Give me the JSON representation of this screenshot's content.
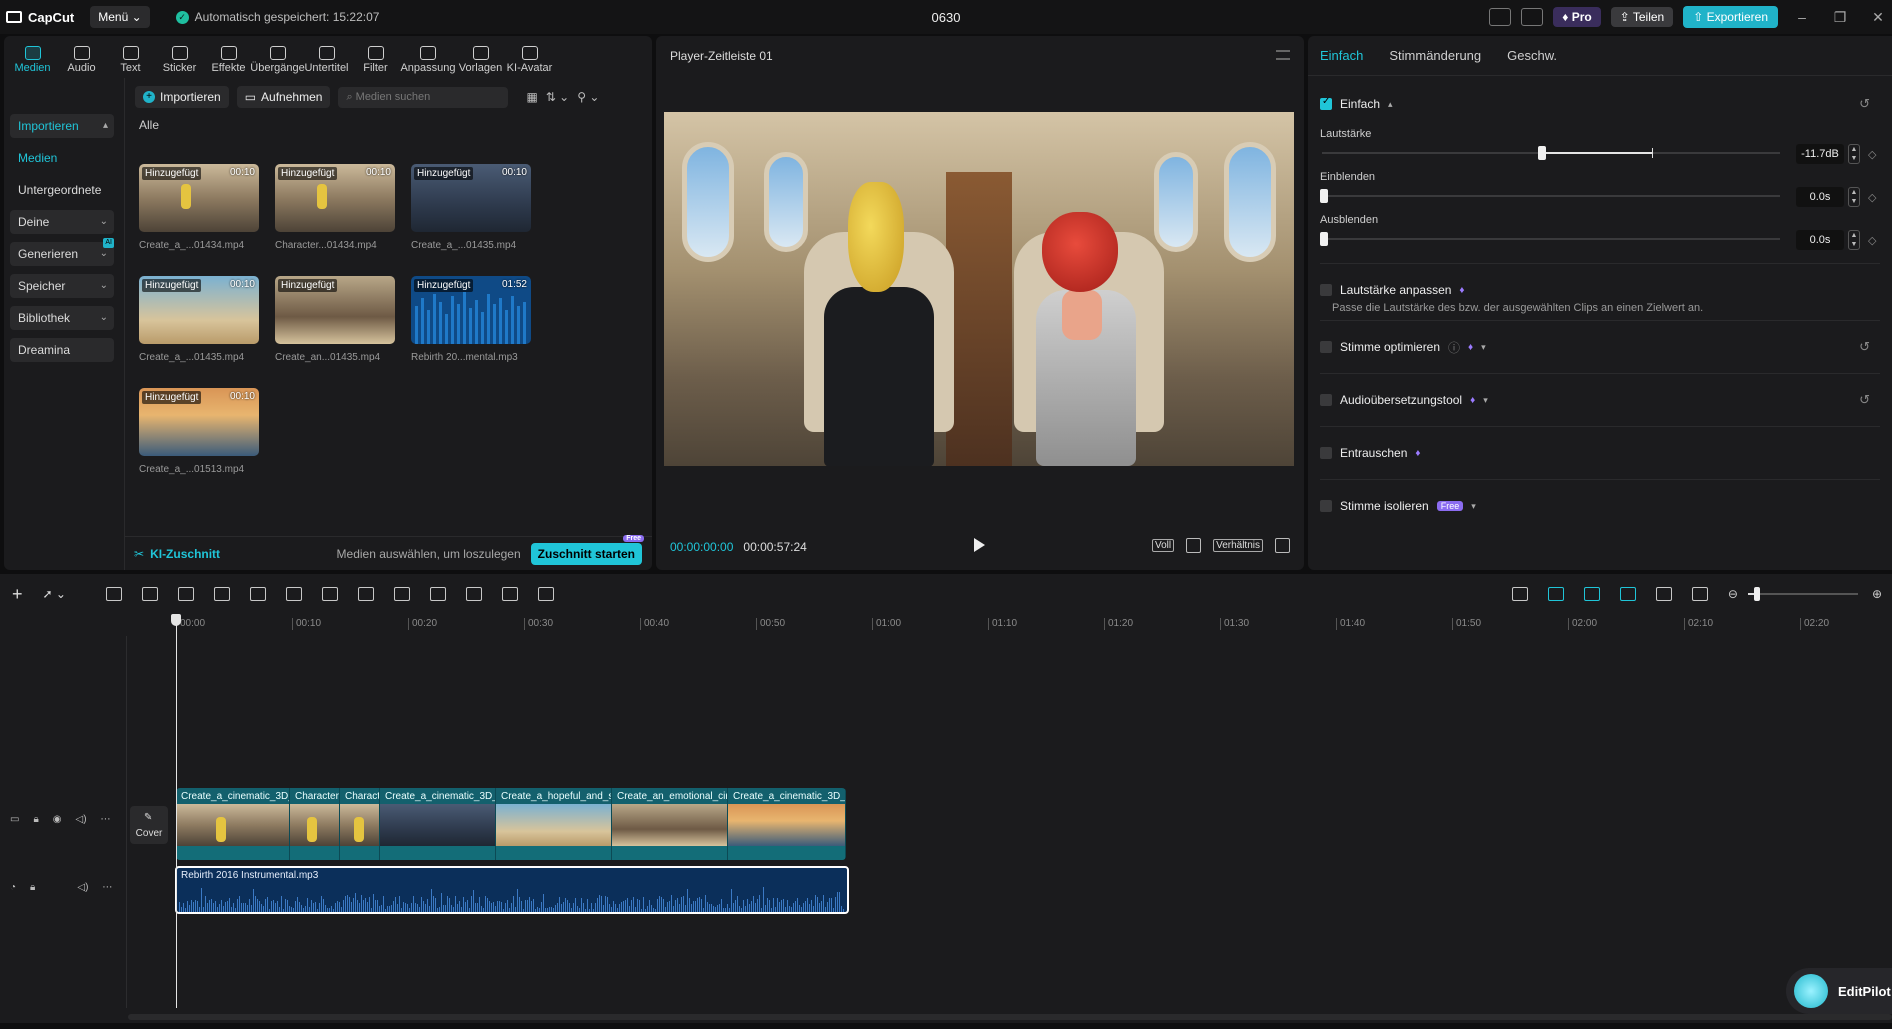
{
  "app": {
    "name": "CapCut",
    "menu_label": "Menü",
    "autosave": "Automatisch gespeichert: 15:22:07",
    "project_title": "0630",
    "pro_label": "Pro",
    "share_label": "Teilen",
    "export_label": "Exportieren"
  },
  "toolbar": {
    "items": [
      {
        "label": "Medien",
        "icon": "media-icon"
      },
      {
        "label": "Audio",
        "icon": "audio-icon"
      },
      {
        "label": "Text",
        "icon": "text-icon"
      },
      {
        "label": "Sticker",
        "icon": "sticker-icon"
      },
      {
        "label": "Effekte",
        "icon": "effects-icon"
      },
      {
        "label": "Übergänge",
        "icon": "transitions-icon"
      },
      {
        "label": "Untertitel",
        "icon": "subtitles-icon"
      },
      {
        "label": "Filter",
        "icon": "filter-icon"
      },
      {
        "label": "Anpassung",
        "icon": "adjust-icon"
      },
      {
        "label": "Vorlagen",
        "icon": "templates-icon"
      },
      {
        "label": "KI-Avatar",
        "icon": "avatar-icon"
      }
    ]
  },
  "sidenav": {
    "items": [
      "Importieren",
      "Medien",
      "Untergeordnete ...",
      "Deine",
      "Generieren",
      "Speicher",
      "Bibliothek",
      "Dreamina"
    ],
    "ai_badge": "AI"
  },
  "media": {
    "import_label": "Importieren",
    "record_label": "Aufnehmen",
    "search_placeholder": "Medien suchen",
    "filter_all": "Alle",
    "added_label": "Hinzugefügt",
    "items": [
      {
        "name": "Create_a_...01434.mp4",
        "duration": "00:10"
      },
      {
        "name": "Character...01434.mp4",
        "duration": "00:10"
      },
      {
        "name": "Create_a_...01435.mp4",
        "duration": "00:10"
      },
      {
        "name": "Create_a_...01435.mp4",
        "duration": "00:10"
      },
      {
        "name": "Create_an...01435.mp4",
        "duration": ""
      },
      {
        "name": "Rebirth 20...mental.mp3",
        "duration": "01:52"
      },
      {
        "name": "Create_a_...01513.mp4",
        "duration": "00:10"
      }
    ]
  },
  "ki": {
    "title": "KI-Zuschnitt",
    "hint": "Medien auswählen, um loszulegen",
    "button": "Zuschnitt starten",
    "free": "Free"
  },
  "player": {
    "title": "Player-Zeitleiste 01",
    "current_time": "00:00:00:00",
    "duration": "00:00:57:24",
    "full_label": "Voll",
    "ratio_label": "Verhältnis"
  },
  "props": {
    "tabs": [
      "Einfach",
      "Stimmänderung",
      "Geschw."
    ],
    "basic_label": "Einfach",
    "volume_label": "Lautstärke",
    "volume_value": "-11.7dB",
    "volume_level": 0.48,
    "fadein_label": "Einblenden",
    "fadein_value": "0.0s",
    "fadeout_label": "Ausblenden",
    "fadeout_value": "0.0s",
    "normalize_label": "Lautstärke anpassen",
    "normalize_desc": "Passe die Lautstärke des bzw. der ausgewählten Clips an einen Zielwert an.",
    "enhance_label": "Stimme optimieren",
    "translate_label": "Audioübersetzungstool",
    "denoise_label": "Entrauschen",
    "isolate_label": "Stimme isolieren",
    "free_label": "Free"
  },
  "timeline": {
    "ticks": [
      "00:00",
      "00:10",
      "00:20",
      "00:30",
      "00:40",
      "00:50",
      "01:00",
      "01:10",
      "01:20",
      "01:30",
      "01:40",
      "01:50",
      "02:00",
      "02:10",
      "02:20"
    ],
    "cover_label": "Cover",
    "clips": [
      {
        "label": "Create_a_cinematic_3D_"
      },
      {
        "label": "Character"
      },
      {
        "label": "Charact"
      },
      {
        "label": "Create_a_cinematic_3D_"
      },
      {
        "label": "Create_a_hopeful_and_s"
      },
      {
        "label": "Create_an_emotional_cir"
      },
      {
        "label": "Create_a_cinematic_3D_"
      }
    ],
    "audio_label": "Rebirth 2016 Instrumental.mp3"
  },
  "assistant": {
    "label": "EditPilot"
  }
}
